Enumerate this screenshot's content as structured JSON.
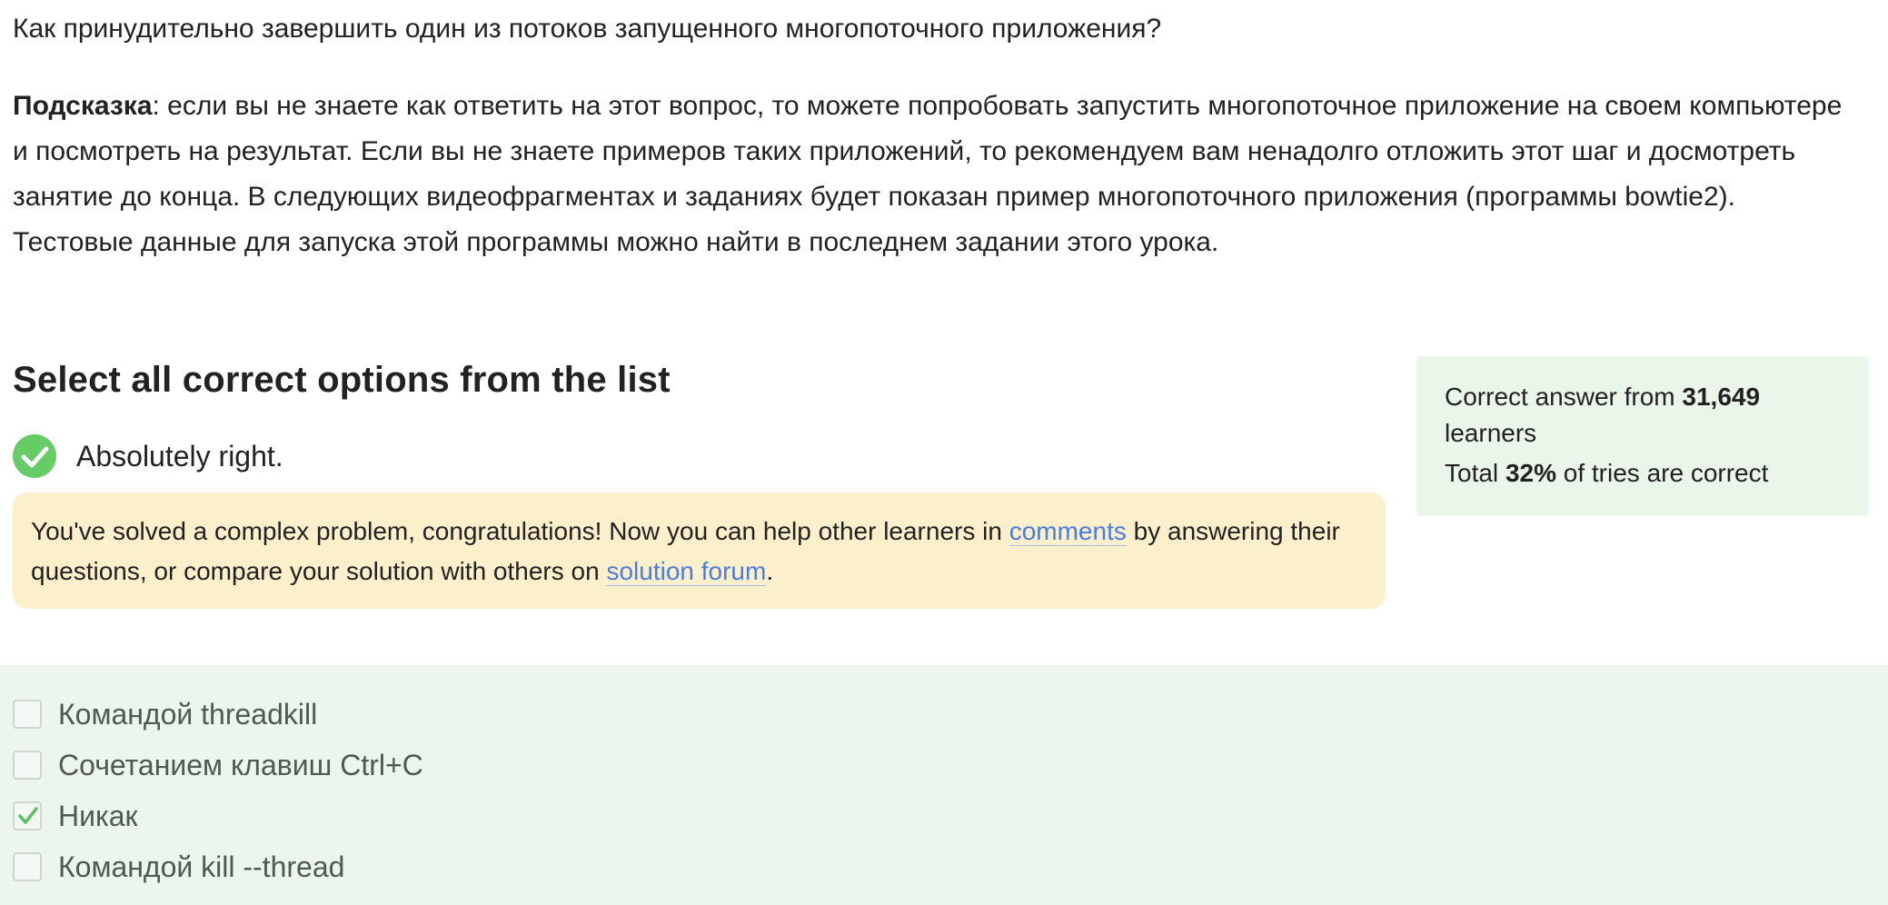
{
  "question": {
    "text": "Как принудительно завершить один из потоков запущенного многопоточного приложения?"
  },
  "hint": {
    "label": "Подсказка",
    "text": ": если вы не знаете как ответить на этот вопрос, то можете попробовать запустить многопоточное приложение на своем компьютере и посмотреть на результат. Если вы не знаете примеров таких приложений, то рекомендуем вам ненадолго отложить этот шаг и досмотреть занятие до конца. В следующих видеофрагментах и заданиях будет показан пример многопоточного приложения (программы bowtie2). Тестовые данные для запуска этой программы можно найти в последнем задании этого урока."
  },
  "section": {
    "title": "Select all correct options from the list"
  },
  "result": {
    "icon": "check-circle-icon",
    "text": "Absolutely right.",
    "color": "#66cc66"
  },
  "notice": {
    "text_before": "You've solved a complex problem, congratulations! Now you can help other learners in ",
    "link_comments": "comments",
    "text_middle": " by answering their questions, or compare your solution with others on ",
    "link_forum": "solution forum",
    "text_after": ".",
    "background": "#fcefcb",
    "link_color": "#4a7ddd"
  },
  "stats": {
    "prefix": "Correct answer from ",
    "learners_count": "31,649",
    "suffix": " learners",
    "total_prefix": "Total ",
    "percent": "32%",
    "total_suffix": " of tries are correct",
    "background": "#ebf6eb"
  },
  "options": [
    {
      "label": "Командой threadkill",
      "checked": false
    },
    {
      "label": "Сочетанием клавиш Ctrl+C",
      "checked": false
    },
    {
      "label": "Никак",
      "checked": true
    },
    {
      "label": "Командой kill --thread",
      "checked": false
    }
  ]
}
